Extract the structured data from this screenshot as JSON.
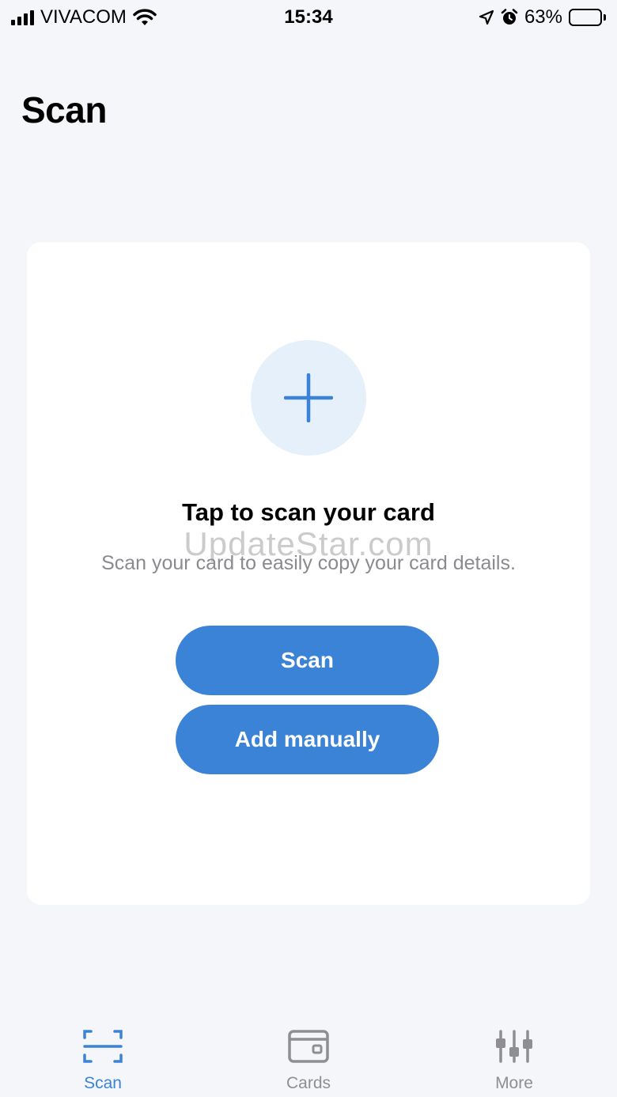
{
  "status_bar": {
    "carrier": "VIVACOM",
    "time": "15:34",
    "battery_percent": "63%",
    "battery_level": 0.63
  },
  "header": {
    "title": "Scan"
  },
  "card": {
    "heading": "Tap to scan your card",
    "subtitle": "Scan your card to easily copy your card details.",
    "scan_button": "Scan",
    "add_button": "Add manually"
  },
  "watermark": "UpdateStar.com",
  "tabs": [
    {
      "label": "Scan",
      "icon": "scan-frame-icon",
      "active": true
    },
    {
      "label": "Cards",
      "icon": "wallet-icon",
      "active": false
    },
    {
      "label": "More",
      "icon": "sliders-icon",
      "active": false
    }
  ],
  "colors": {
    "accent": "#3b83d6",
    "background": "#f4f6f9",
    "plus_circle": "#e6f0fb",
    "inactive": "#8e8e93"
  }
}
